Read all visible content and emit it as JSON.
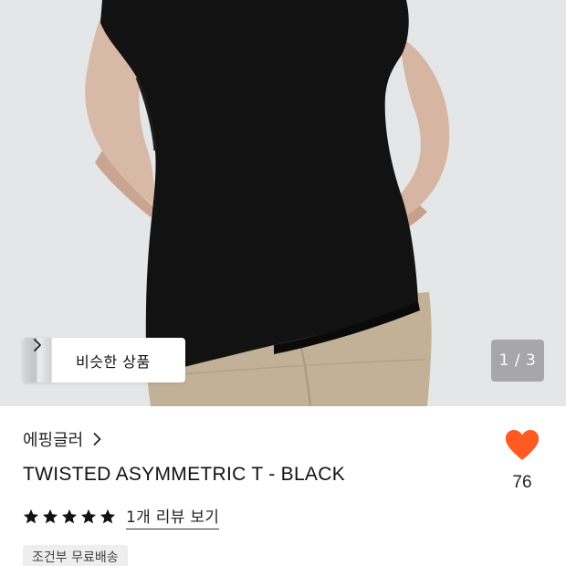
{
  "gallery": {
    "similar_label": "비슷한 상품",
    "page_indicator": "1 / 3"
  },
  "product": {
    "brand": "에핑글러",
    "title": "TWISTED ASYMMETRIC T - BLACK",
    "likes": "76",
    "rating": {
      "stars": 5,
      "max": 5
    },
    "review_link": "1개 리뷰 보기",
    "shipping_badge": "조건부 무료배송"
  },
  "icons": {
    "heart": "heart-icon",
    "star": "star-icon",
    "chevron": "chevron-right-icon"
  },
  "colors": {
    "heart": "#FF5A1F",
    "stars": "#111111",
    "badge_bg": "#EEEEEE"
  }
}
